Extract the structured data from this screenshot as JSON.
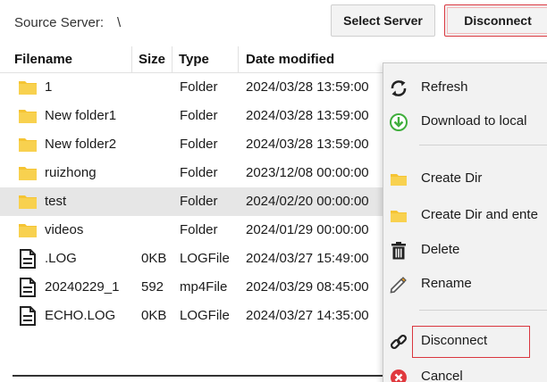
{
  "header": {
    "source_label": "Source Server:",
    "source_path": "\\",
    "select_server_label": "Select Server",
    "disconnect_label": "Disconnect"
  },
  "table": {
    "columns": [
      "Filename",
      "Size",
      "Type",
      "Date modified"
    ],
    "rows": [
      {
        "icon": "folder-icon",
        "name": "1",
        "size": "",
        "type": "Folder",
        "date": "2024/03/28 13:59:00",
        "selected": false
      },
      {
        "icon": "folder-icon",
        "name": "New folder1",
        "size": "",
        "type": "Folder",
        "date": "2024/03/28 13:59:00",
        "selected": false
      },
      {
        "icon": "folder-icon",
        "name": "New folder2",
        "size": "",
        "type": "Folder",
        "date": "2024/03/28 13:59:00",
        "selected": false
      },
      {
        "icon": "folder-icon",
        "name": "ruizhong",
        "size": "",
        "type": "Folder",
        "date": "2023/12/08 00:00:00",
        "selected": false
      },
      {
        "icon": "folder-icon",
        "name": "test",
        "size": "",
        "type": "Folder",
        "date": "2024/02/20 00:00:00",
        "selected": true
      },
      {
        "icon": "folder-icon",
        "name": "videos",
        "size": "",
        "type": "Folder",
        "date": "2024/01/29 00:00:00",
        "selected": false
      },
      {
        "icon": "file-icon",
        "name": ".LOG",
        "size": "0KB",
        "type": "LOGFile",
        "date": "2024/03/27 15:49:00",
        "selected": false
      },
      {
        "icon": "file-icon",
        "name": "20240229_1",
        "size": "592",
        "type": "mp4File",
        "date": "2024/03/29 08:45:00",
        "selected": false
      },
      {
        "icon": "file-icon",
        "name": "ECHO.LOG",
        "size": "0KB",
        "type": "LOGFile",
        "date": "2024/03/27 14:35:00",
        "selected": false
      }
    ]
  },
  "context_menu": {
    "items": [
      {
        "label": "Refresh",
        "icon": "refresh-icon"
      },
      {
        "label": "Download to local",
        "icon": "download-icon"
      },
      {
        "label": "Create Dir",
        "icon": "folder-icon"
      },
      {
        "label": "Create Dir and ente",
        "icon": "folder-icon"
      },
      {
        "label": "Delete",
        "icon": "trash-icon"
      },
      {
        "label": "Rename",
        "icon": "pencil-icon"
      },
      {
        "label": "Disconnect",
        "icon": "link-icon"
      },
      {
        "label": "Cancel",
        "icon": "cancel-icon"
      }
    ]
  },
  "colors": {
    "accent_red": "#d9363e",
    "folder_yellow": "#f5c433",
    "download_green": "#3fae3c",
    "cancel_red": "#e0393e"
  }
}
